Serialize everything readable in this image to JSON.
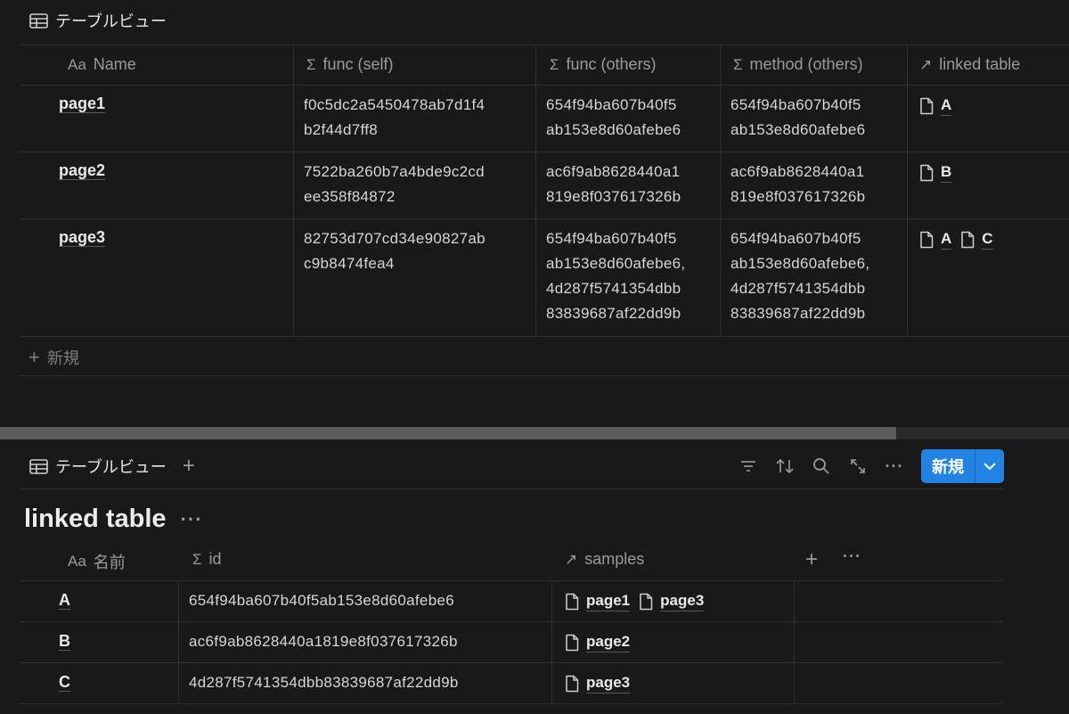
{
  "top_view": {
    "tab_label": "テーブルビュー",
    "columns": [
      {
        "icon": "Aa",
        "label": "Name"
      },
      {
        "icon": "Σ",
        "label": "func (self)"
      },
      {
        "icon": "Σ",
        "label": "func (others)"
      },
      {
        "icon": "Σ",
        "label": "method (others)"
      },
      {
        "icon": "↗",
        "label": "linked table"
      }
    ],
    "rows": [
      {
        "name": "page1",
        "func_self": [
          "f0c5dc2a5450478ab7d1f4",
          "b2f44d7ff8"
        ],
        "func_others": [
          "654f94ba607b40f5",
          "ab153e8d60afebe6"
        ],
        "method_others": [
          "654f94ba607b40f5",
          "ab153e8d60afebe6"
        ],
        "linked": [
          "A"
        ]
      },
      {
        "name": "page2",
        "func_self": [
          "7522ba260b7a4bde9c2cd",
          "ee358f84872"
        ],
        "func_others": [
          "ac6f9ab8628440a1",
          "819e8f037617326b"
        ],
        "method_others": [
          "ac6f9ab8628440a1",
          "819e8f037617326b"
        ],
        "linked": [
          "B"
        ]
      },
      {
        "name": "page3",
        "func_self": [
          "82753d707cd34e90827ab",
          "c9b8474fea4"
        ],
        "func_others": [
          "654f94ba607b40f5",
          "ab153e8d60afebe6,",
          "4d287f5741354dbb",
          "83839687af22dd9b"
        ],
        "method_others": [
          "654f94ba607b40f5",
          "ab153e8d60afebe6,",
          "4d287f5741354dbb",
          "83839687af22dd9b"
        ],
        "linked": [
          "A",
          "C"
        ]
      }
    ],
    "new_label": "新規"
  },
  "scrollbar": {
    "position_fraction": 0.84
  },
  "bottom_view": {
    "tab_label": "テーブルビュー",
    "add_view_label": "+",
    "toolbar_icons": [
      "filter-icon",
      "sort-icon",
      "search-icon",
      "expand-icon",
      "more-icon"
    ],
    "new_button_label": "新規",
    "accent_color": "#2383e2",
    "database_title": "linked table",
    "columns": [
      {
        "icon": "Aa",
        "label": "名前"
      },
      {
        "icon": "Σ",
        "label": "id"
      },
      {
        "icon": "↗",
        "label": "samples"
      }
    ],
    "rows": [
      {
        "name": "A",
        "id": "654f94ba607b40f5ab153e8d60afebe6",
        "samples": [
          "page1",
          "page3"
        ]
      },
      {
        "name": "B",
        "id": "ac6f9ab8628440a1819e8f037617326b",
        "samples": [
          "page2"
        ]
      },
      {
        "name": "C",
        "id": "4d287f5741354dbb83839687af22dd9b",
        "samples": [
          "page3"
        ]
      }
    ]
  }
}
